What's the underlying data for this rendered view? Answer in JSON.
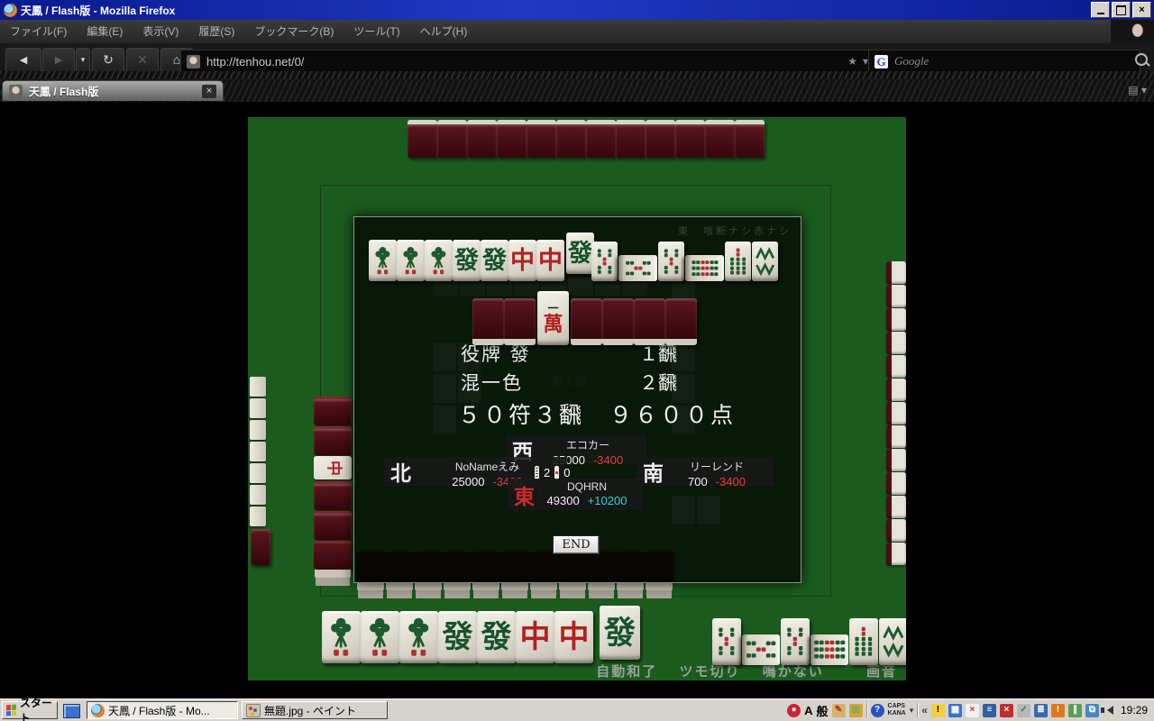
{
  "window": {
    "title": "天鳳 / Flash版 - Mozilla Firefox"
  },
  "menubar": {
    "items": [
      "ファイル(F)",
      "編集(E)",
      "表示(V)",
      "履歴(S)",
      "ブックマーク(B)",
      "ツール(T)",
      "ヘルプ(H)"
    ]
  },
  "toolbar": {
    "url": "http://tenhou.net/0/",
    "search_placeholder": "Google"
  },
  "tabbar": {
    "active_tab": "天鳳 / Flash版"
  },
  "icons": {
    "back": "◄",
    "forward": "►",
    "dropdown": "▾",
    "refresh": "↻",
    "stop": "✕",
    "home": "⌂",
    "star": "★",
    "close_tab": "×",
    "win_close": "×",
    "tab_list": "▤",
    "overflow": "«",
    "g_letter": "G"
  },
  "game": {
    "rules_note": "東　喰断ナシ赤ナシ",
    "round_faint": "東1局",
    "yaku": [
      {
        "name": "役牌 發",
        "han": "１飜"
      },
      {
        "name": "混一色",
        "han": "２飜"
      }
    ],
    "total": "５０符３飜　９６００点",
    "players": {
      "west": {
        "wind": "西",
        "name": "エコカー",
        "score": "25000",
        "delta": "-3400"
      },
      "north": {
        "wind": "北",
        "name": "NoNameえみ",
        "score": "25000",
        "delta": "-3400"
      },
      "south": {
        "wind": "南",
        "name": "リーレンド",
        "score": "700",
        "delta": "-3400"
      },
      "east": {
        "wind": "東",
        "name": "DQHRN",
        "score": "49300",
        "delta": "+10200"
      }
    },
    "sticks": {
      "honba": "2",
      "riichi": "0"
    },
    "end_button": "END",
    "options": [
      "自動和了",
      "ツモ切り",
      "鳴かない",
      "画音"
    ],
    "colors": {
      "table_green": "#1b5c1e",
      "negative": "#e04040",
      "positive": "#2fd6d6",
      "dealer_wind": "#cf2a2a",
      "tile_back": "#4a1016"
    },
    "tiles": {
      "glyphs": {
        "hatsu": "發",
        "chun": "中",
        "man_top": "一",
        "man_bottom": "萬"
      },
      "dialog_hand": [
        "s1",
        "s1",
        "s1",
        "hatsu",
        "hatsu",
        "chun",
        "chun"
      ],
      "dialog_winning": "hatsu",
      "melds": [
        "s5",
        "s5r",
        "s5",
        "s9r",
        "s7",
        "s8"
      ],
      "dead_wall": [
        "back",
        "back",
        "man1",
        "back",
        "back",
        "back",
        "back"
      ],
      "bottom_hand": [
        "s1",
        "s1",
        "s1",
        "hatsu",
        "hatsu",
        "chun",
        "chun"
      ],
      "bottom_winning": "hatsu",
      "left_wall": [
        "back",
        "back",
        "chun_side",
        "back",
        "back",
        "back"
      ],
      "top_wall_count": 12,
      "bottom_wall_count": 11,
      "right_side_count": 13,
      "left_edge_count": 7
    }
  },
  "taskbar": {
    "start": "スタート",
    "tasks": [
      {
        "title": "天鳳 / Flash版 - Mo...",
        "active": true
      },
      {
        "title": "無題.jpg - ペイント",
        "active": false
      }
    ],
    "ime": {
      "mode": "A",
      "general": "般",
      "caps": "CAPS",
      "kana": "KANA"
    },
    "clock": "19:29"
  }
}
